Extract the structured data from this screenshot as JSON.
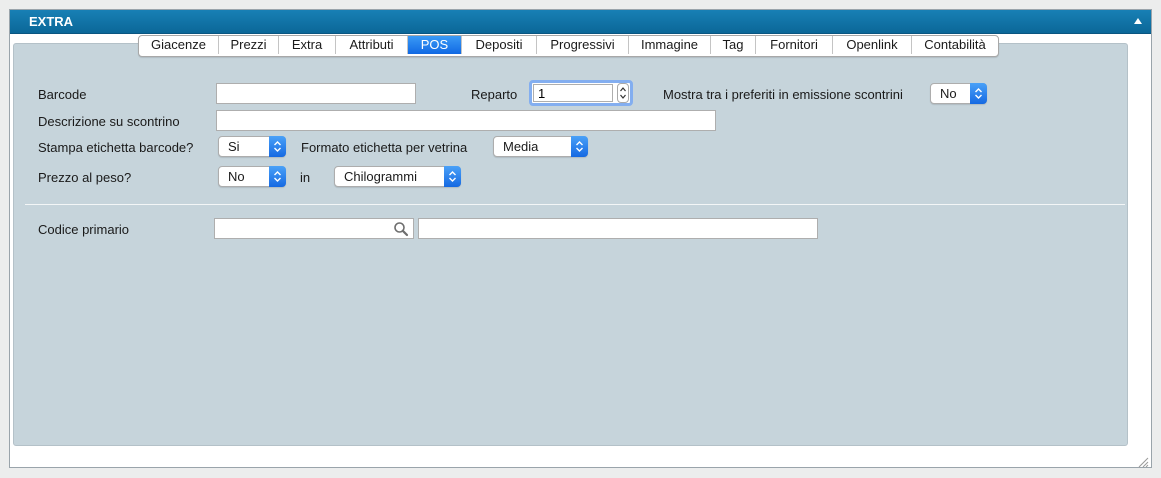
{
  "panel": {
    "title": "EXTRA"
  },
  "tabs": [
    {
      "label": "Giacenze",
      "active": false
    },
    {
      "label": "Prezzi",
      "active": false
    },
    {
      "label": "Extra",
      "active": false
    },
    {
      "label": "Attributi",
      "active": false
    },
    {
      "label": "POS",
      "active": true
    },
    {
      "label": "Depositi",
      "active": false
    },
    {
      "label": "Progressivi",
      "active": false
    },
    {
      "label": "Immagine",
      "active": false
    },
    {
      "label": "Tag",
      "active": false
    },
    {
      "label": "Fornitori",
      "active": false
    },
    {
      "label": "Openlink",
      "active": false
    },
    {
      "label": "Contabilità",
      "active": false
    }
  ],
  "form": {
    "barcode": {
      "label": "Barcode",
      "value": ""
    },
    "reparto": {
      "label": "Reparto",
      "value": "1"
    },
    "preferiti": {
      "label": "Mostra tra i preferiti in emissione scontrini",
      "value": "No"
    },
    "descrizione": {
      "label": "Descrizione su scontrino",
      "value": ""
    },
    "stampa_etichetta": {
      "label": "Stampa etichetta barcode?",
      "value": "Si"
    },
    "formato_etichetta": {
      "label": "Formato etichetta per vetrina",
      "value": "Media"
    },
    "prezzo_peso": {
      "label": "Prezzo al peso?",
      "value": "No"
    },
    "unita": {
      "label": "in",
      "value": "Chilogrammi"
    },
    "codice_primario": {
      "label": "Codice primario",
      "value": "",
      "description": ""
    }
  },
  "colors": {
    "titlebar": "#0b6798",
    "active_tab": "#1169e3",
    "inner_panel": "#c6d4db",
    "focus_ring": "#83aef0"
  },
  "icons": {
    "collapse": "chevron-up-icon",
    "search": "magnifier-icon",
    "resize": "resize-grip-icon"
  }
}
